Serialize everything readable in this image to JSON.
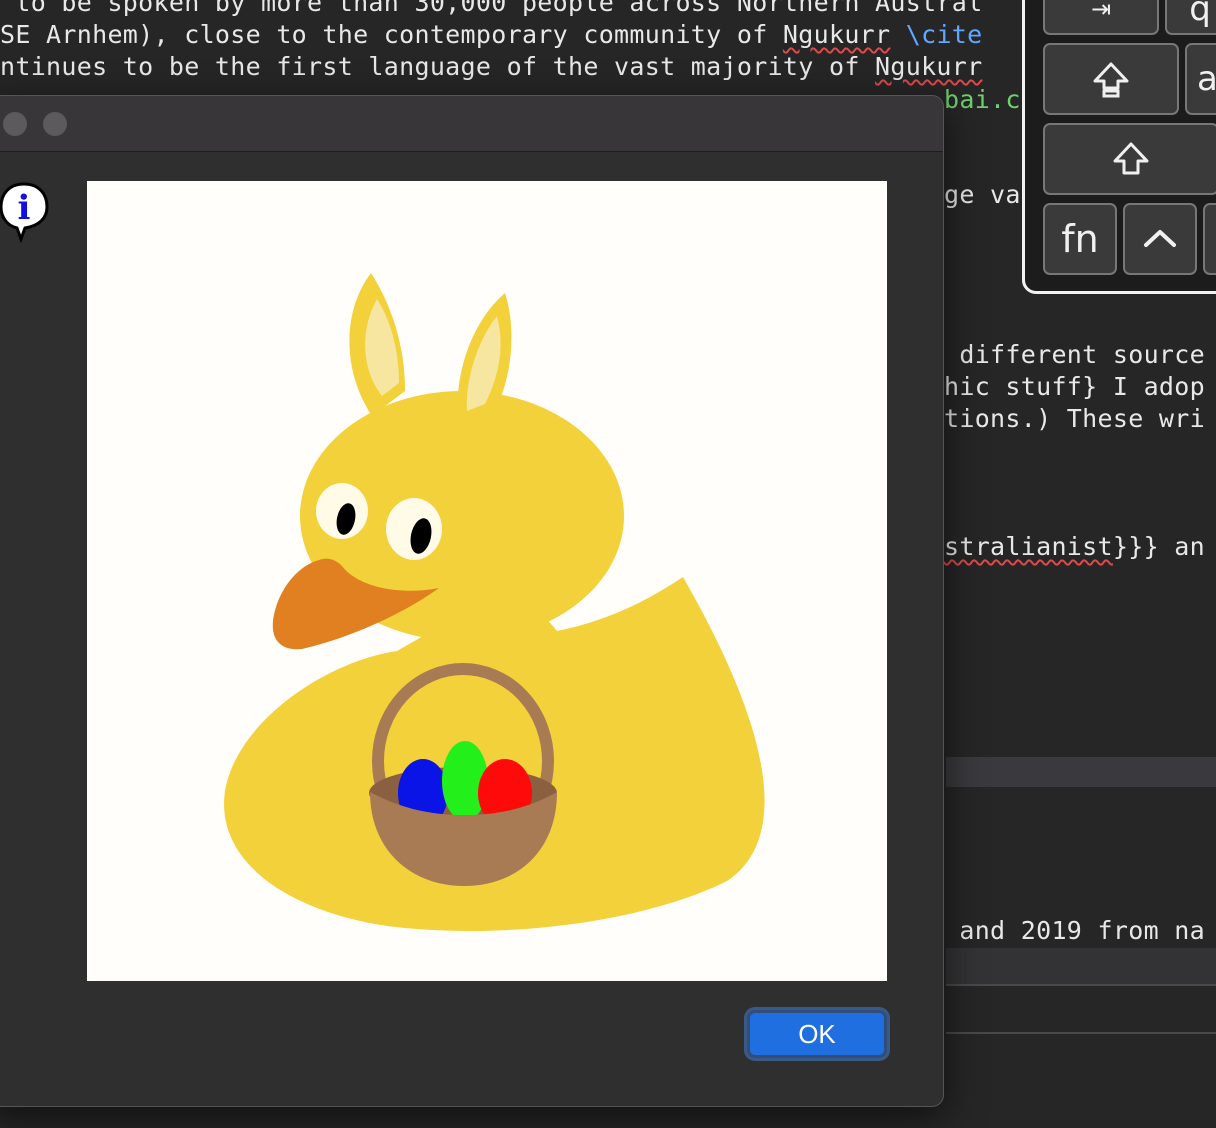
{
  "editor": {
    "lines": [
      " to be spoken by more than 30,000 people across Northern Austral",
      "SE Arnhem), close to the contemporary community of ",
      "ntinues to be the first language of the vast majority of "
    ],
    "line2_word": "Ngukurr",
    "line2_cite": " \\cite",
    "line3_word": "Ngukurr",
    "line4_tail": "bai.c",
    "right_fragments": {
      "ge_va": "ge va",
      "different": " different source",
      "hic": "hic stuff} I adop",
      "tions": "tions.) These wri",
      "stral_word": "stralianist",
      "stral_tail": "}}} an",
      "and2019": " and 2019 from na"
    }
  },
  "keyboard": {
    "key_tab": "⇥",
    "key_q": "q",
    "key_caps": "⇪",
    "key_a": "a",
    "key_shift": "⇧",
    "key_fn": "fn",
    "key_ctrl": "^"
  },
  "dialog": {
    "ok_label": "OK",
    "info_icon_glyph": "i",
    "icon": "info-icon",
    "image": "easter-duck-with-bunny-ears-and-egg-basket"
  },
  "colors": {
    "ok_accent": "#1f6fe0",
    "duck_yellow": "#f2d13a",
    "beak_orange": "#e08020",
    "basket_brown": "#a87b55",
    "egg_blue": "#0a14e6",
    "egg_green": "#23f01a",
    "egg_red": "#ff0a0a"
  }
}
